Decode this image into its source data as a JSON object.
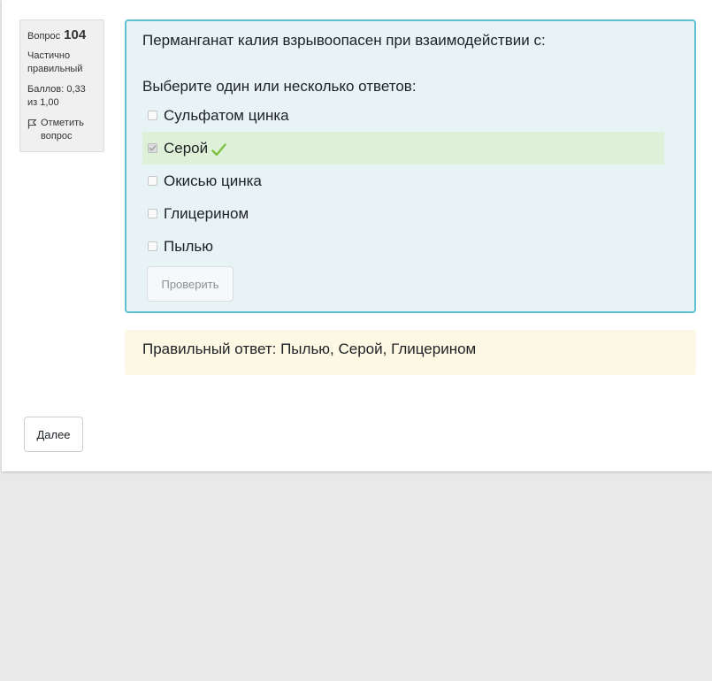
{
  "question_info": {
    "label": "Вопрос",
    "number": "104",
    "state": "Частично правильный",
    "grade": "Баллов: 0,33 из 1,00",
    "flag_label": "Отметить вопрос"
  },
  "question": {
    "text": "Перманганат калия взрывоопасен при взаимодействии с:",
    "prompt": "Выберите один или несколько ответов:",
    "options": [
      {
        "label": "Сульфатом цинка",
        "checked": false,
        "correct": false
      },
      {
        "label": "Серой",
        "checked": true,
        "correct": true
      },
      {
        "label": "Окисью цинка",
        "checked": false,
        "correct": false
      },
      {
        "label": "Глицерином",
        "checked": false,
        "correct": false
      },
      {
        "label": "Пылью",
        "checked": false,
        "correct": false
      }
    ],
    "check_button": "Проверить"
  },
  "feedback": {
    "right_answer": "Правильный ответ: Пылью, Серой, Глицерином"
  },
  "navigation": {
    "next_button": "Далее"
  },
  "colors": {
    "formulation_bg": "#e7f3f5",
    "formulation_border": "#5fc3cf",
    "correct_bg": "#dff0d8",
    "tick": "#7cc242",
    "outcome_bg": "#fcf8e3"
  },
  "icons": {
    "flag": "flag-icon",
    "correct": "checkmark-icon"
  }
}
